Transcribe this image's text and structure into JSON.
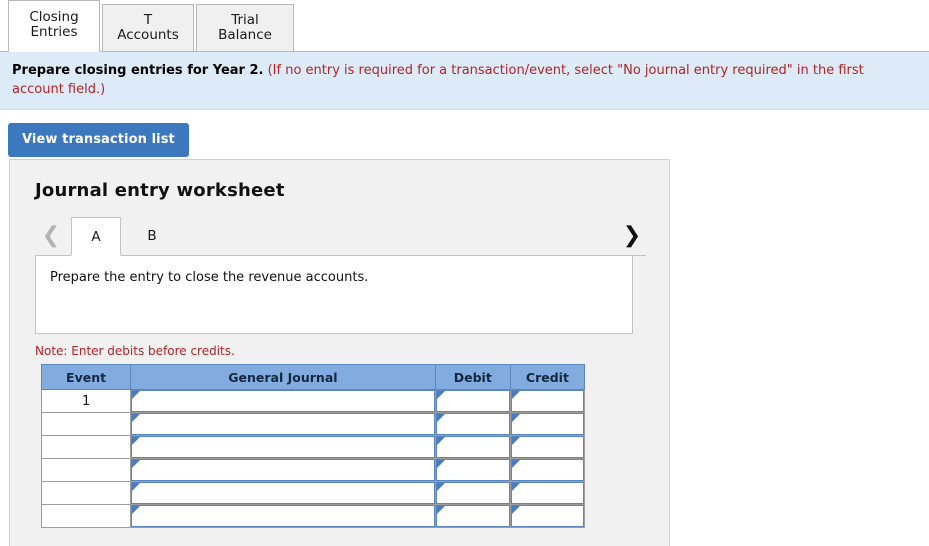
{
  "tabs": [
    {
      "label": "Closing Entries",
      "active": true
    },
    {
      "label": "T Accounts",
      "active": false
    },
    {
      "label": "Trial Balance",
      "active": false
    }
  ],
  "banner": {
    "main": "Prepare closing entries for Year 2.",
    "requirement": "(If no entry is required for a transaction/event, select \"No journal entry required\" in the first account field.)"
  },
  "toolbar": {
    "view_transaction_list_label": "View transaction list"
  },
  "worksheet": {
    "title": "Journal entry worksheet",
    "prev_icon": "chevron-left-icon",
    "next_icon": "chevron-right-icon",
    "subtabs": [
      {
        "label": "A",
        "active": true
      },
      {
        "label": "B",
        "active": false
      }
    ],
    "prompt": "Prepare the entry to close the revenue accounts.",
    "note": "Note: Enter debits before credits.",
    "table": {
      "headers": [
        "Event",
        "General Journal",
        "Debit",
        "Credit"
      ],
      "rows": [
        {
          "event": "1",
          "general_journal": "",
          "debit": "",
          "credit": ""
        },
        {
          "event": "",
          "general_journal": "",
          "debit": "",
          "credit": ""
        },
        {
          "event": "",
          "general_journal": "",
          "debit": "",
          "credit": ""
        },
        {
          "event": "",
          "general_journal": "",
          "debit": "",
          "credit": ""
        },
        {
          "event": "",
          "general_journal": "",
          "debit": "",
          "credit": ""
        },
        {
          "event": "",
          "general_journal": "",
          "debit": "",
          "credit": ""
        }
      ]
    }
  },
  "colors": {
    "banner_bg": "#dcebf7",
    "required_text": "#b02525",
    "button_blue": "#3b78be",
    "table_header_blue": "#82acdf",
    "field_border_blue": "#5b87bf",
    "panel_bg": "#f1f1f1"
  }
}
